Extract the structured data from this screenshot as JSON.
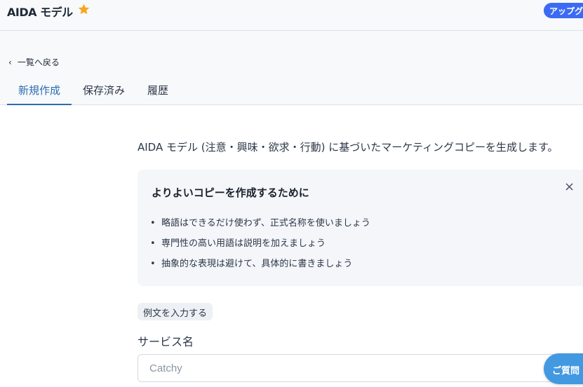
{
  "header": {
    "title": "AIDA モデル",
    "upgrade_label": "アップグ"
  },
  "nav": {
    "back_label": "一覧へ戻る",
    "tabs": [
      {
        "label": "新規作成",
        "active": true
      },
      {
        "label": "保存済み",
        "active": false
      },
      {
        "label": "履歴",
        "active": false
      }
    ]
  },
  "main": {
    "description": "AIDA モデル (注意・興味・欲求・行動) に基づいたマーケティングコピーを生成します。",
    "tips": {
      "title": "よりよいコピーを作成するために",
      "close_label": "×",
      "items": [
        "略語はできるだけ使わず、正式名称を使いましょう",
        "専門性の高い用語は説明を加えましょう",
        "抽象的な表現は避けて、具体的に書きましょう"
      ]
    },
    "example_button": "例文を入力する",
    "service_field": {
      "label": "サービス名",
      "placeholder": "Catchy",
      "value": ""
    }
  },
  "help_bubble": "ご質問",
  "colors": {
    "accent": "#2b6cb0",
    "upgrade": "#3b6bf5",
    "star": "#f6a623",
    "help": "#4299e1"
  },
  "icons": [
    "star-icon",
    "chevron-left-icon",
    "close-icon"
  ]
}
